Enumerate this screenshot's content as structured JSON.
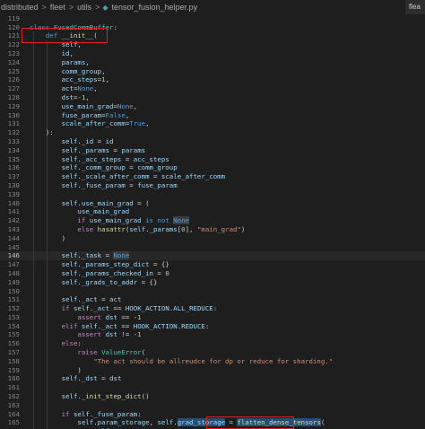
{
  "breadcrumbs": [
    {
      "label": "distributed"
    },
    {
      "label": "fleet"
    },
    {
      "label": "utils"
    },
    {
      "label": "tensor_fusion_helper.py",
      "icon": "python-file-icon"
    }
  ],
  "breadcrumb_separator": ">",
  "right_tab_label": "flea",
  "current_line": 146,
  "theme": {
    "background": "#1e1e1e",
    "keyword": "#569cd6",
    "control": "#c586c0",
    "function": "#dcdcaa",
    "class": "#4ec9b0",
    "variable": "#9cdcfe",
    "number": "#b5cea8",
    "string": "#ce9178",
    "annotation_box": "#e02020"
  },
  "lines": [
    {
      "n": "",
      "tokens": [
        [
          "        ",
          ""
        ],
        [
          "return",
          "ctrl"
        ],
        [
          " fused_comm",
          "var"
        ]
      ]
    },
    {
      "n": "119",
      "tokens": []
    },
    {
      "n": "120",
      "tokens": [
        [
          "class",
          "kw"
        ],
        [
          " ",
          ""
        ],
        [
          "FusedCommBuffer",
          "cls"
        ],
        [
          ":",
          "op"
        ]
      ]
    },
    {
      "n": "121",
      "tokens": [
        [
          "    ",
          ""
        ],
        [
          "def",
          "kw"
        ],
        [
          " ",
          ""
        ],
        [
          "__init__",
          "fn"
        ],
        [
          "(",
          "op"
        ]
      ]
    },
    {
      "n": "122",
      "tokens": [
        [
          "        ",
          ""
        ],
        [
          "self",
          "var"
        ],
        [
          ",",
          "op"
        ]
      ]
    },
    {
      "n": "123",
      "tokens": [
        [
          "        ",
          ""
        ],
        [
          "id",
          "var"
        ],
        [
          ",",
          "op"
        ]
      ]
    },
    {
      "n": "124",
      "tokens": [
        [
          "        ",
          ""
        ],
        [
          "params",
          "var"
        ],
        [
          ",",
          "op"
        ]
      ]
    },
    {
      "n": "125",
      "tokens": [
        [
          "        ",
          ""
        ],
        [
          "comm_group",
          "var"
        ],
        [
          ",",
          "op"
        ]
      ]
    },
    {
      "n": "126",
      "tokens": [
        [
          "        ",
          ""
        ],
        [
          "acc_steps",
          "var"
        ],
        [
          "=",
          "op"
        ],
        [
          "1",
          "num"
        ],
        [
          ",",
          "op"
        ]
      ]
    },
    {
      "n": "127",
      "tokens": [
        [
          "        ",
          ""
        ],
        [
          "act",
          "var"
        ],
        [
          "=",
          "op"
        ],
        [
          "None",
          "kw"
        ],
        [
          ",",
          "op"
        ]
      ]
    },
    {
      "n": "128",
      "tokens": [
        [
          "        ",
          ""
        ],
        [
          "dst",
          "var"
        ],
        [
          "=-",
          "op"
        ],
        [
          "1",
          "num"
        ],
        [
          ",",
          "op"
        ]
      ]
    },
    {
      "n": "129",
      "tokens": [
        [
          "        ",
          ""
        ],
        [
          "use_main_grad",
          "var"
        ],
        [
          "=",
          "op"
        ],
        [
          "None",
          "kw"
        ],
        [
          ",",
          "op"
        ]
      ]
    },
    {
      "n": "130",
      "tokens": [
        [
          "        ",
          ""
        ],
        [
          "fuse_param",
          "var"
        ],
        [
          "=",
          "op"
        ],
        [
          "False",
          "kw"
        ],
        [
          ",",
          "op"
        ]
      ]
    },
    {
      "n": "131",
      "tokens": [
        [
          "        ",
          ""
        ],
        [
          "scale_after_comm",
          "var"
        ],
        [
          "=",
          "op"
        ],
        [
          "True",
          "kw"
        ],
        [
          ",",
          "op"
        ]
      ]
    },
    {
      "n": "132",
      "tokens": [
        [
          "    ",
          ""
        ],
        [
          "):",
          "op"
        ]
      ]
    },
    {
      "n": "133",
      "tokens": [
        [
          "        ",
          ""
        ],
        [
          "self",
          "var"
        ],
        [
          ".",
          "op"
        ],
        [
          "_id",
          "var"
        ],
        [
          " = ",
          "op"
        ],
        [
          "id",
          "var"
        ]
      ]
    },
    {
      "n": "134",
      "tokens": [
        [
          "        ",
          ""
        ],
        [
          "self",
          "var"
        ],
        [
          ".",
          "op"
        ],
        [
          "_params",
          "var"
        ],
        [
          " = ",
          "op"
        ],
        [
          "params",
          "var"
        ]
      ]
    },
    {
      "n": "135",
      "tokens": [
        [
          "        ",
          ""
        ],
        [
          "self",
          "var"
        ],
        [
          ".",
          "op"
        ],
        [
          "_acc_steps",
          "var"
        ],
        [
          " = ",
          "op"
        ],
        [
          "acc_steps",
          "var"
        ]
      ]
    },
    {
      "n": "136",
      "tokens": [
        [
          "        ",
          ""
        ],
        [
          "self",
          "var"
        ],
        [
          ".",
          "op"
        ],
        [
          "_comm_group",
          "var"
        ],
        [
          " = ",
          "op"
        ],
        [
          "comm_group",
          "var"
        ]
      ]
    },
    {
      "n": "137",
      "tokens": [
        [
          "        ",
          ""
        ],
        [
          "self",
          "var"
        ],
        [
          ".",
          "op"
        ],
        [
          "_scale_after_comm",
          "var"
        ],
        [
          " = ",
          "op"
        ],
        [
          "scale_after_comm",
          "var"
        ]
      ]
    },
    {
      "n": "138",
      "tokens": [
        [
          "        ",
          ""
        ],
        [
          "self",
          "var"
        ],
        [
          ".",
          "op"
        ],
        [
          "_fuse_param",
          "var"
        ],
        [
          " = ",
          "op"
        ],
        [
          "fuse_param",
          "var"
        ]
      ]
    },
    {
      "n": "139",
      "tokens": []
    },
    {
      "n": "140",
      "tokens": [
        [
          "        ",
          ""
        ],
        [
          "self",
          "var"
        ],
        [
          ".",
          "op"
        ],
        [
          "use_main_grad",
          "var"
        ],
        [
          " = (",
          "op"
        ]
      ]
    },
    {
      "n": "141",
      "tokens": [
        [
          "            ",
          ""
        ],
        [
          "use_main_grad",
          "var"
        ]
      ]
    },
    {
      "n": "142",
      "tokens": [
        [
          "            ",
          ""
        ],
        [
          "if",
          "ctrl"
        ],
        [
          " ",
          ""
        ],
        [
          "use_main_grad",
          "var"
        ],
        [
          " ",
          ""
        ],
        [
          "is not",
          "kw"
        ],
        [
          " ",
          ""
        ],
        [
          "None",
          "kw hl"
        ]
      ]
    },
    {
      "n": "143",
      "tokens": [
        [
          "            ",
          ""
        ],
        [
          "else",
          "ctrl"
        ],
        [
          " ",
          ""
        ],
        [
          "hasattr",
          "fn"
        ],
        [
          "(",
          "op"
        ],
        [
          "self",
          "var"
        ],
        [
          ".",
          "op"
        ],
        [
          "_params",
          "var"
        ],
        [
          "[",
          "op"
        ],
        [
          "0",
          "num"
        ],
        [
          "], ",
          "op"
        ],
        [
          "\"main_grad\"",
          "str"
        ],
        [
          ")",
          "op"
        ]
      ]
    },
    {
      "n": "144",
      "tokens": [
        [
          "        ",
          ""
        ],
        [
          ")",
          "op"
        ]
      ]
    },
    {
      "n": "145",
      "tokens": []
    },
    {
      "n": "146",
      "tokens": [
        [
          "        ",
          ""
        ],
        [
          "self",
          "var"
        ],
        [
          ".",
          "op"
        ],
        [
          "_task",
          "var"
        ],
        [
          " = ",
          "op"
        ],
        [
          "None",
          "kw hl"
        ]
      ]
    },
    {
      "n": "147",
      "tokens": [
        [
          "        ",
          ""
        ],
        [
          "self",
          "var"
        ],
        [
          ".",
          "op"
        ],
        [
          "_params_step_dict",
          "var"
        ],
        [
          " = {}",
          "op"
        ]
      ]
    },
    {
      "n": "148",
      "tokens": [
        [
          "        ",
          ""
        ],
        [
          "self",
          "var"
        ],
        [
          ".",
          "op"
        ],
        [
          "_params_checked_in",
          "var"
        ],
        [
          " = ",
          "op"
        ],
        [
          "0",
          "num"
        ]
      ]
    },
    {
      "n": "149",
      "tokens": [
        [
          "        ",
          ""
        ],
        [
          "self",
          "var"
        ],
        [
          ".",
          "op"
        ],
        [
          "_grads_to_addr",
          "var"
        ],
        [
          " = {}",
          "op"
        ]
      ]
    },
    {
      "n": "150",
      "tokens": []
    },
    {
      "n": "151",
      "tokens": [
        [
          "        ",
          ""
        ],
        [
          "self",
          "var"
        ],
        [
          ".",
          "op"
        ],
        [
          "_act",
          "var"
        ],
        [
          " = ",
          "op"
        ],
        [
          "act",
          "var"
        ]
      ]
    },
    {
      "n": "152",
      "tokens": [
        [
          "        ",
          ""
        ],
        [
          "if",
          "ctrl"
        ],
        [
          " ",
          ""
        ],
        [
          "self",
          "var"
        ],
        [
          ".",
          "op"
        ],
        [
          "_act",
          "var"
        ],
        [
          " == ",
          "op"
        ],
        [
          "HOOK_ACTION",
          "var"
        ],
        [
          ".",
          "op"
        ],
        [
          "ALL_REDUCE",
          "var"
        ],
        [
          ":",
          "op"
        ]
      ]
    },
    {
      "n": "153",
      "tokens": [
        [
          "            ",
          ""
        ],
        [
          "assert",
          "ctrl"
        ],
        [
          " ",
          ""
        ],
        [
          "dst",
          "var"
        ],
        [
          " == -",
          "op"
        ],
        [
          "1",
          "num"
        ]
      ]
    },
    {
      "n": "154",
      "tokens": [
        [
          "        ",
          ""
        ],
        [
          "elif",
          "ctrl"
        ],
        [
          " ",
          ""
        ],
        [
          "self",
          "var"
        ],
        [
          ".",
          "op"
        ],
        [
          "_act",
          "var"
        ],
        [
          " == ",
          "op"
        ],
        [
          "HOOK_ACTION",
          "var"
        ],
        [
          ".",
          "op"
        ],
        [
          "REDUCE",
          "var"
        ],
        [
          ":",
          "op"
        ]
      ]
    },
    {
      "n": "155",
      "tokens": [
        [
          "            ",
          ""
        ],
        [
          "assert",
          "ctrl"
        ],
        [
          " ",
          ""
        ],
        [
          "dst",
          "var"
        ],
        [
          " != -",
          "op"
        ],
        [
          "1",
          "num"
        ]
      ]
    },
    {
      "n": "156",
      "tokens": [
        [
          "        ",
          ""
        ],
        [
          "else",
          "ctrl"
        ],
        [
          ":",
          "op"
        ]
      ]
    },
    {
      "n": "157",
      "tokens": [
        [
          "            ",
          ""
        ],
        [
          "raise",
          "ctrl"
        ],
        [
          " ",
          ""
        ],
        [
          "ValueError",
          "cls"
        ],
        [
          "(",
          "op"
        ]
      ]
    },
    {
      "n": "158",
      "tokens": [
        [
          "                ",
          ""
        ],
        [
          "\"The act should be allreudce for dp or reduce for sharding.\"",
          "str"
        ]
      ]
    },
    {
      "n": "159",
      "tokens": [
        [
          "            ",
          ""
        ],
        [
          ")",
          "op"
        ]
      ]
    },
    {
      "n": "160",
      "tokens": [
        [
          "        ",
          ""
        ],
        [
          "self",
          "var"
        ],
        [
          ".",
          "op"
        ],
        [
          "_dst",
          "var"
        ],
        [
          " = ",
          "op"
        ],
        [
          "dst",
          "var"
        ]
      ]
    },
    {
      "n": "161",
      "tokens": []
    },
    {
      "n": "162",
      "tokens": [
        [
          "        ",
          ""
        ],
        [
          "self",
          "var"
        ],
        [
          ".",
          "op"
        ],
        [
          "_init_step_dict",
          "fn"
        ],
        [
          "()",
          "op"
        ]
      ]
    },
    {
      "n": "163",
      "tokens": []
    },
    {
      "n": "164",
      "tokens": [
        [
          "        ",
          ""
        ],
        [
          "if",
          "ctrl"
        ],
        [
          " ",
          ""
        ],
        [
          "self",
          "var"
        ],
        [
          ".",
          "op"
        ],
        [
          "_fuse_param",
          "var"
        ],
        [
          ":",
          "op"
        ]
      ]
    },
    {
      "n": "165",
      "tokens": [
        [
          "            ",
          ""
        ],
        [
          "self",
          "var"
        ],
        [
          ".",
          "op"
        ],
        [
          "param_storage",
          "var"
        ],
        [
          ", ",
          "op"
        ],
        [
          "self",
          "var"
        ],
        [
          ".",
          "op"
        ],
        [
          "grad_storage",
          "var sel"
        ],
        [
          " = ",
          "op"
        ],
        [
          "flatten_dense_tensors",
          "fn sel"
        ],
        [
          "(",
          "op"
        ]
      ]
    },
    {
      "n": "166",
      "tokens": [
        [
          "                ",
          ""
        ],
        [
          "self",
          "var"
        ],
        [
          ".",
          "op"
        ],
        [
          "_params",
          "var"
        ],
        [
          ",",
          "op"
        ]
      ]
    }
  ]
}
